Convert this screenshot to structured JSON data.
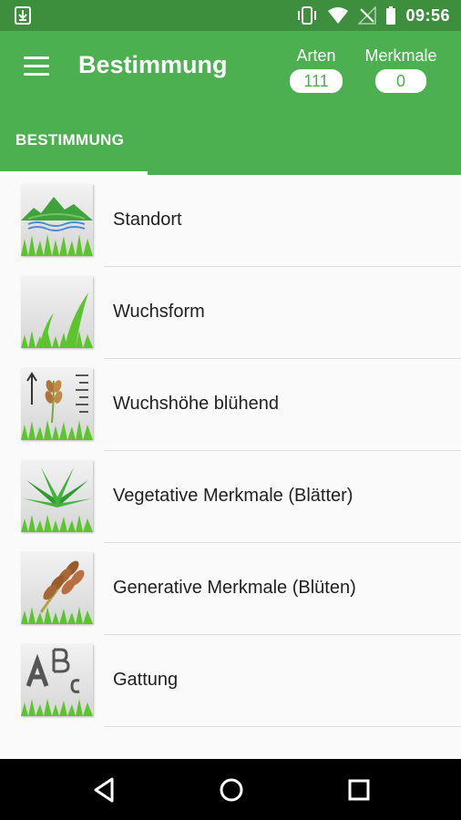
{
  "status_bar": {
    "time": "09:56",
    "icons": [
      "download-icon",
      "vibrate-icon",
      "wifi-icon",
      "no-signal-icon",
      "battery-icon"
    ]
  },
  "app_bar": {
    "title": "Bestimmung",
    "counters": {
      "arten": {
        "label": "Arten",
        "value": "111"
      },
      "merkmale": {
        "label": "Merkmale",
        "value": "0"
      }
    },
    "tab": "BESTIMMUNG"
  },
  "list": [
    {
      "label": "Standort",
      "icon": "landscape-icon"
    },
    {
      "label": "Wuchsform",
      "icon": "grass-growth-icon"
    },
    {
      "label": "Wuchshöhe blühend",
      "icon": "height-scale-icon"
    },
    {
      "label": "Vegetative Merkmale (Blätter)",
      "icon": "leaves-icon"
    },
    {
      "label": "Generative Merkmale (Blüten)",
      "icon": "flower-ear-icon"
    },
    {
      "label": "Gattung",
      "icon": "letters-abc-icon"
    }
  ],
  "nav_bar": {
    "buttons": [
      "back",
      "home",
      "recent-apps"
    ]
  },
  "colors": {
    "primary": "#4caf50",
    "status_bar": "#3d8f3d",
    "grass": "#5cc52e"
  }
}
